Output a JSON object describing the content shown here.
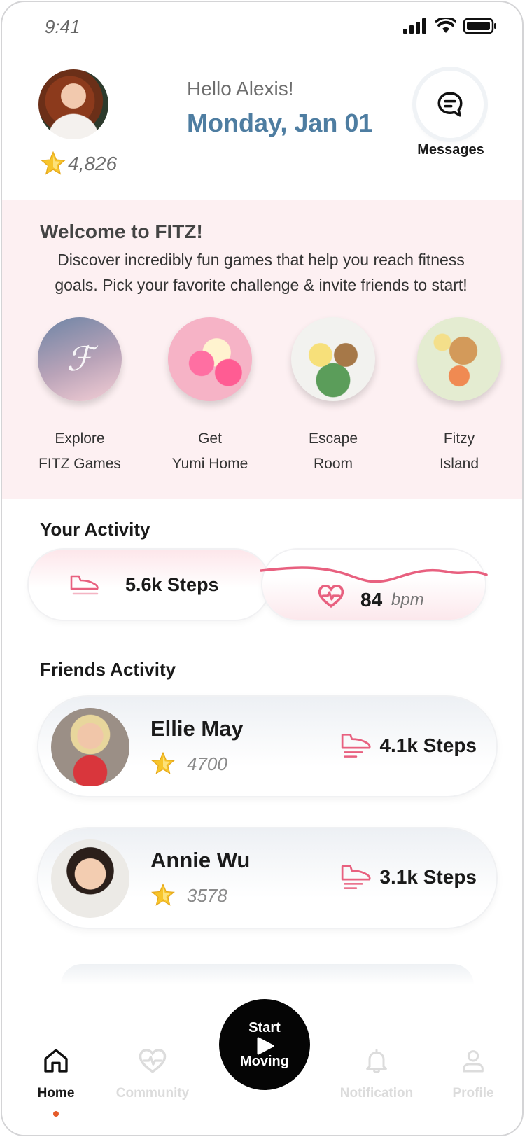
{
  "status_bar": {
    "time": "9:41"
  },
  "header": {
    "points": "4,826",
    "greeting": "Hello Alexis!",
    "date": "Monday, Jan 01",
    "messages_label": "Messages"
  },
  "welcome": {
    "title": "Welcome to FITZ!",
    "description": "Discover incredibly fun games that help you reach fitness goals. Pick your favorite challenge & invite friends to start!",
    "games": [
      {
        "line1": "Explore",
        "line2": "FITZ Games"
      },
      {
        "line1": "Get",
        "line2": "Yumi Home"
      },
      {
        "line1": "Escape",
        "line2": "Room"
      },
      {
        "line1": "Fitzy",
        "line2": "Island"
      }
    ]
  },
  "your_activity": {
    "title": "Your Activity",
    "steps": "5.6k Steps",
    "bpm_value": "84",
    "bpm_unit": "bpm"
  },
  "friends_activity": {
    "title": "Friends Activity",
    "friends": [
      {
        "name": "Ellie May",
        "points": "4700",
        "steps": "4.1k Steps"
      },
      {
        "name": "Annie Wu",
        "points": "3578",
        "steps": "3.1k Steps"
      }
    ]
  },
  "tabbar": {
    "home": "Home",
    "community": "Community",
    "start_line1": "Start",
    "start_line2": "Moving",
    "notification": "Notification",
    "profile": "Profile"
  },
  "colors": {
    "accent_blue": "#4e7da1",
    "accent_pink": "#e8607f",
    "welcome_bg": "#fdf0f2",
    "active_dot": "#e55b2a"
  }
}
